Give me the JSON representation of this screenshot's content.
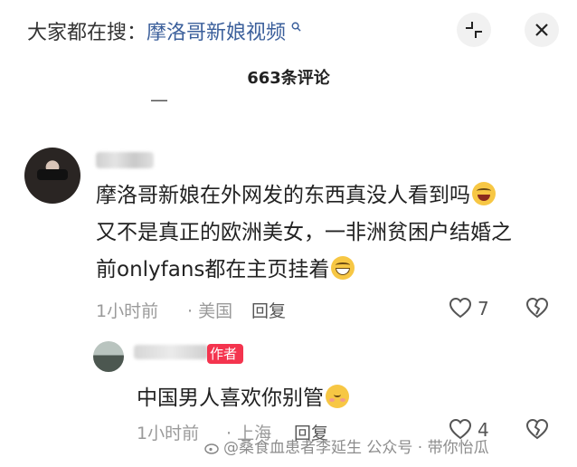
{
  "header": {
    "search_prefix": "大家都在搜：",
    "search_keyword": "摩洛哥新娘视频",
    "search_icon": "search-icon",
    "collapse_icon": "collapse-arrows-icon",
    "close_icon": "close-icon",
    "comment_count": "663条评论"
  },
  "comments": [
    {
      "text_line1": "摩洛哥新娘在外网发的东西真没人看到吗",
      "text_line2": "又不是真正的欧洲美女，一非洲贫困户结婚之",
      "text_line3": "前onlyfans都在主页挂着",
      "time": "1小时前",
      "location": "· 美国",
      "reply_label": "回复",
      "like_count": "7"
    }
  ],
  "reply": {
    "badge": "作者",
    "text": "中国男人喜欢你别管",
    "time": "1小时前",
    "location": "· 上海",
    "reply_label": "回复",
    "like_count": "4"
  },
  "watermark": {
    "text": "@桑食血患者李延生  公众号 · 带你怡瓜"
  },
  "colors": {
    "keyword": "#3b5f9b",
    "author_badge": "#f4344e",
    "meta_gray": "#9a9a9a"
  }
}
